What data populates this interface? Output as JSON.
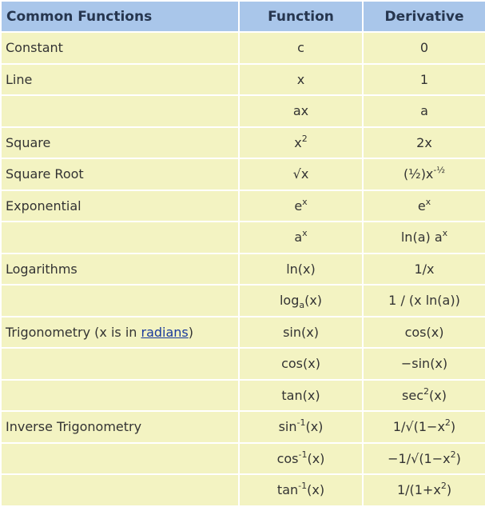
{
  "header": {
    "col1": "Common Functions",
    "col2": "Function",
    "col3": "Derivative"
  },
  "rows": [
    {
      "name": "Constant",
      "fn": "c",
      "dv": "0"
    },
    {
      "name": "Line",
      "fn": "x",
      "dv": "1"
    },
    {
      "name": "",
      "fn": "ax",
      "dv": "a"
    },
    {
      "name": "Square",
      "fn_base": "x",
      "fn_sup": "2",
      "dv": "2x"
    },
    {
      "name": "Square Root",
      "fn": "√x",
      "dv_pre": "(½)x",
      "dv_sup": "-½"
    },
    {
      "name": "Exponential",
      "fn_base": "e",
      "fn_sup": "x",
      "dv_base": "e",
      "dv_sup": "x"
    },
    {
      "name": "",
      "fn_base": "a",
      "fn_sup": "x",
      "dv_pre": "ln(a) a",
      "dv_sup": "x"
    },
    {
      "name": "Logarithms",
      "fn": "ln(x)",
      "dv": "1/x"
    },
    {
      "name": "",
      "fn_pre": "log",
      "fn_sub": "a",
      "fn_post": "(x)",
      "dv": "1 / (x ln(a))"
    },
    {
      "name_pre": "Trigonometry (x is in ",
      "name_link": "radians",
      "name_post": ")",
      "fn": "sin(x)",
      "dv": "cos(x)"
    },
    {
      "name": "",
      "fn": "cos(x)",
      "dv": "−sin(x)"
    },
    {
      "name": "",
      "fn": "tan(x)",
      "dv_pre": "sec",
      "dv_sup": "2",
      "dv_post": "(x)"
    },
    {
      "name": "Inverse Trigonometry",
      "fn_pre": "sin",
      "fn_sup": "-1",
      "fn_post": "(x)",
      "dv_pre": "1/√(1−x",
      "dv_sup": "2",
      "dv_post": ")"
    },
    {
      "name": "",
      "fn_pre": "cos",
      "fn_sup": "-1",
      "fn_post": "(x)",
      "dv_pre": "−1/√(1−x",
      "dv_sup": "2",
      "dv_post": ")"
    },
    {
      "name": "",
      "fn_pre": "tan",
      "fn_sup": "-1",
      "fn_post": "(x)",
      "dv_pre": "1/(1+x",
      "dv_sup": "2",
      "dv_post": ")"
    }
  ]
}
